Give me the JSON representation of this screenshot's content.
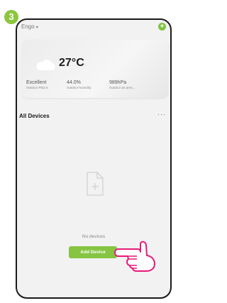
{
  "step": "3",
  "home": {
    "name": "Engo",
    "caret": "▾",
    "add_icon": "+"
  },
  "weather": {
    "temperature": "27°C",
    "stats": [
      {
        "value": "Excellent",
        "label": "Outdoor PM2.5"
      },
      {
        "value": "44.0%",
        "label": "Outdoor humidity"
      },
      {
        "value": "989hPa",
        "label": "Outdoor air pres..."
      }
    ]
  },
  "devices": {
    "title": "All Devices",
    "more": "···",
    "empty_text": "No devices",
    "add_button": "Add Device"
  },
  "colors": {
    "accent": "#86c441",
    "badge": "#8dc63f",
    "hand": "#e6197a"
  }
}
